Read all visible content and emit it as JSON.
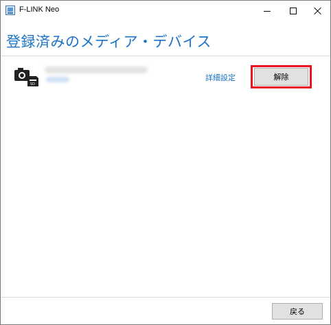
{
  "window": {
    "title": "F-LINK Neo"
  },
  "page": {
    "title": "登録済みのメディア・デバイス"
  },
  "device": {
    "icon": "camera-sd-card-icon",
    "detail_link": "詳細設定",
    "remove_label": "解除"
  },
  "footer": {
    "back_label": "戻る"
  },
  "colors": {
    "accent": "#1a73c8",
    "highlight": "#e8141f",
    "button_face": "#e1e1e1"
  }
}
